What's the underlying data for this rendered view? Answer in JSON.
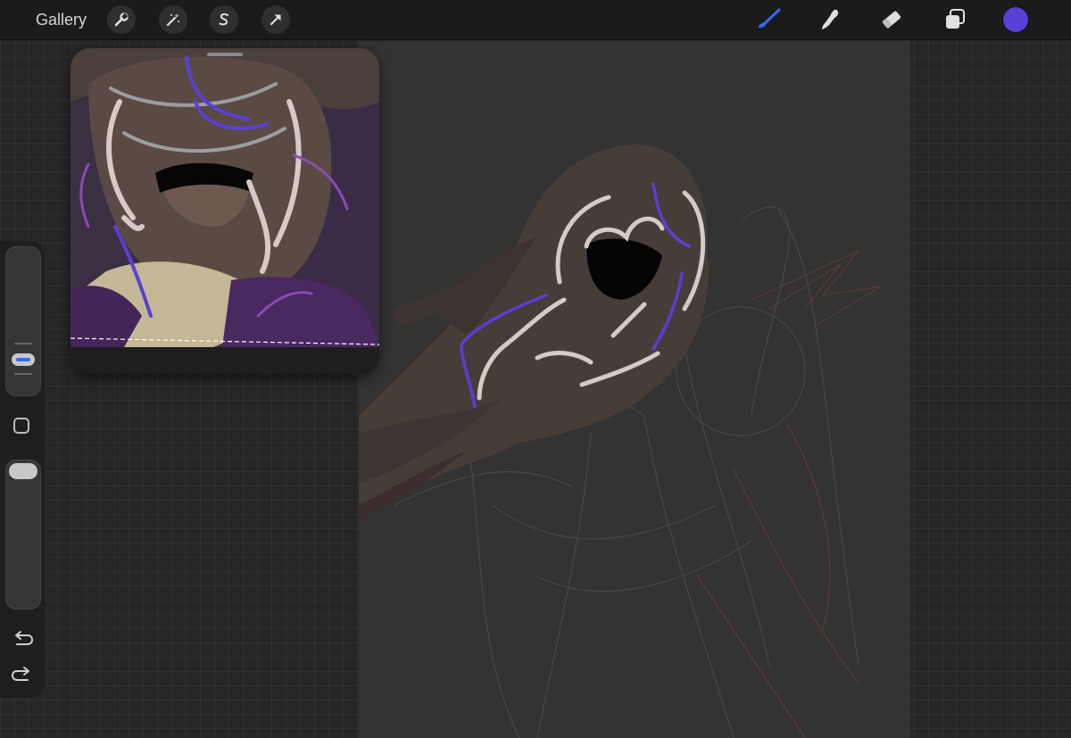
{
  "app": {
    "gallery_label": "Gallery",
    "left_tools": [
      "wrench-icon",
      "magic-wand-icon",
      "selection-s-icon",
      "transform-arrow-icon"
    ],
    "right_tools": [
      "brush-icon",
      "smudge-icon",
      "eraser-icon",
      "layers-icon"
    ],
    "active_tool": "brush-icon",
    "current_color": "#5a3fd4",
    "accent_color": "#2f6bff"
  },
  "reference_window": {
    "visible": true
  },
  "sidebar": {
    "brush_size_level": 0.16,
    "brush_opacity_level": 1.0,
    "controls": [
      "brush-size-slider",
      "modify-button",
      "brush-opacity-slider",
      "undo-icon",
      "redo-icon"
    ]
  },
  "canvas": {
    "palette": {
      "background": "#333333",
      "hair": "#4a403c",
      "highlight": "#d8ccc8",
      "accent": "#5a3fd4",
      "sketch": "#4a4a4a",
      "sketch_red": "#5a3a35"
    }
  }
}
